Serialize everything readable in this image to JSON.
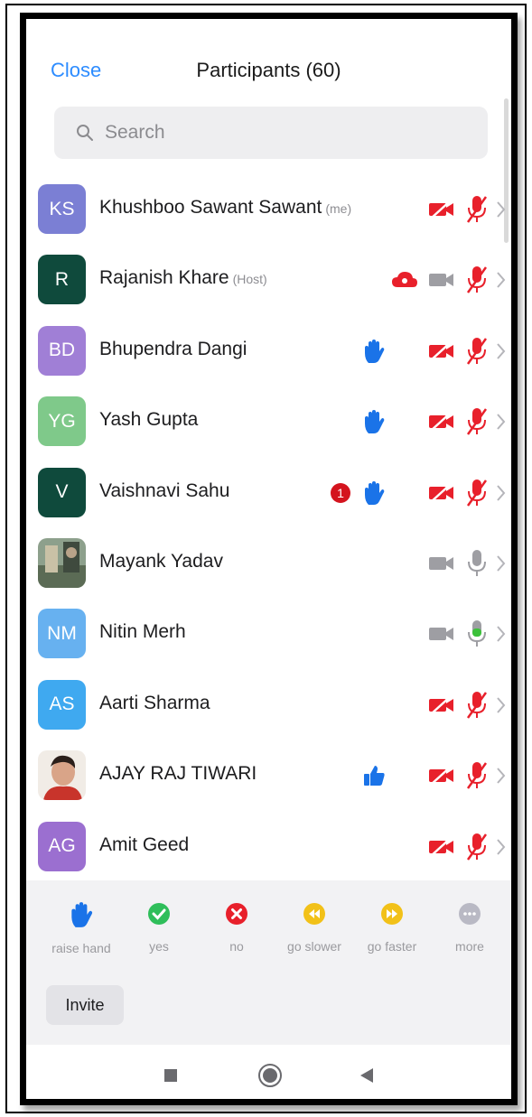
{
  "header": {
    "close_label": "Close",
    "title": "Participants (60)"
  },
  "search": {
    "placeholder": "Search"
  },
  "participants": [
    {
      "initials": "KS",
      "name": "Khushboo Sawant Sawant",
      "tag": "(me)",
      "avatar_color": "#7b7fd4"
    },
    {
      "initials": "R",
      "name": "Rajanish Khare",
      "tag": "(Host)",
      "avatar_color": "#0f4a3c"
    },
    {
      "initials": "BD",
      "name": "Bhupendra Dangi",
      "tag": "",
      "avatar_color": "#a07fd6"
    },
    {
      "initials": "YG",
      "name": "Yash Gupta",
      "tag": "",
      "avatar_color": "#7fc98a"
    },
    {
      "initials": "V",
      "name": "Vaishnavi Sahu",
      "tag": "",
      "avatar_color": "#0f4a3c",
      "chat_badge": "1"
    },
    {
      "initials": "",
      "name": "Mayank Yadav",
      "tag": "",
      "avatar_color": "#6f8f73"
    },
    {
      "initials": "NM",
      "name": "Nitin Merh",
      "tag": "",
      "avatar_color": "#67b1f0"
    },
    {
      "initials": "AS",
      "name": "Aarti Sharma",
      "tag": "",
      "avatar_color": "#3fa9f0"
    },
    {
      "initials": "",
      "name": "AJAY RAJ TIWARI",
      "tag": "",
      "avatar_color": "#d9cfc6"
    },
    {
      "initials": "AG",
      "name": "Amit Geed",
      "tag": "",
      "avatar_color": "#9b6fd0"
    }
  ],
  "reactions": [
    {
      "label": "raise hand",
      "icon": "raise-hand-icon"
    },
    {
      "label": "yes",
      "icon": "check-icon"
    },
    {
      "label": "no",
      "icon": "x-icon"
    },
    {
      "label": "go slower",
      "icon": "rewind-icon"
    },
    {
      "label": "go faster",
      "icon": "fast-forward-icon"
    },
    {
      "label": "more",
      "icon": "more-icon"
    }
  ],
  "invite_label": "Invite",
  "colors": {
    "accent": "#2d8cff",
    "muted_red": "#e8202b",
    "hand_blue": "#1a73e8",
    "active_mic_green": "#3cc13b"
  }
}
